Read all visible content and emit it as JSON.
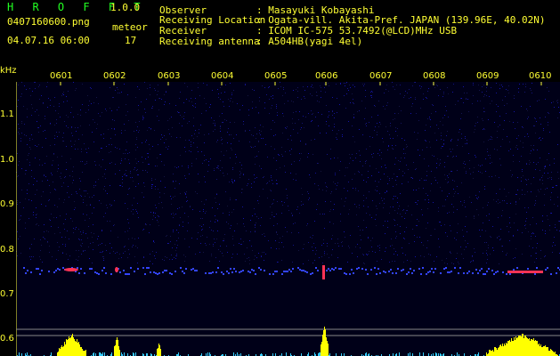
{
  "header": {
    "app_title": "H R O F F T",
    "app_version": "1.0.0",
    "file_name": "0407160600.png",
    "meteor_label": "meteor",
    "date_time": "04.07.16 06:00",
    "meteor_count": "17",
    "info": [
      {
        "key": "Observer",
        "value": ": Masayuki Kobayashi"
      },
      {
        "key": "Receiving Location",
        "value": ": Ogata-vill. Akita-Pref. JAPAN (139.96E, 40.02N)"
      },
      {
        "key": "Receiver",
        "value": ": ICOM IC-575 53.7492(@LCD)MHz USB"
      },
      {
        "key": "Receiving antenna",
        "value": ": A504HB(yagi 4el)"
      }
    ]
  },
  "axes": {
    "y_unit": "kHz",
    "y_ticks": [
      "1.1",
      "1.0",
      "0.9",
      "0.8",
      "0.7",
      "0.6"
    ],
    "x_ticks": [
      "0601",
      "0602",
      "0603",
      "0604",
      "0605",
      "0606",
      "0607",
      "0608",
      "0609",
      "0610"
    ]
  },
  "colors": {
    "header_text": "#ffff33",
    "title_green": "#22ff22",
    "background": "#000018",
    "signal_blue": "#3344ff",
    "echo_red": "#ff3355",
    "level_yellow": "#ffff00",
    "level_cyan": "#33ccff"
  }
}
